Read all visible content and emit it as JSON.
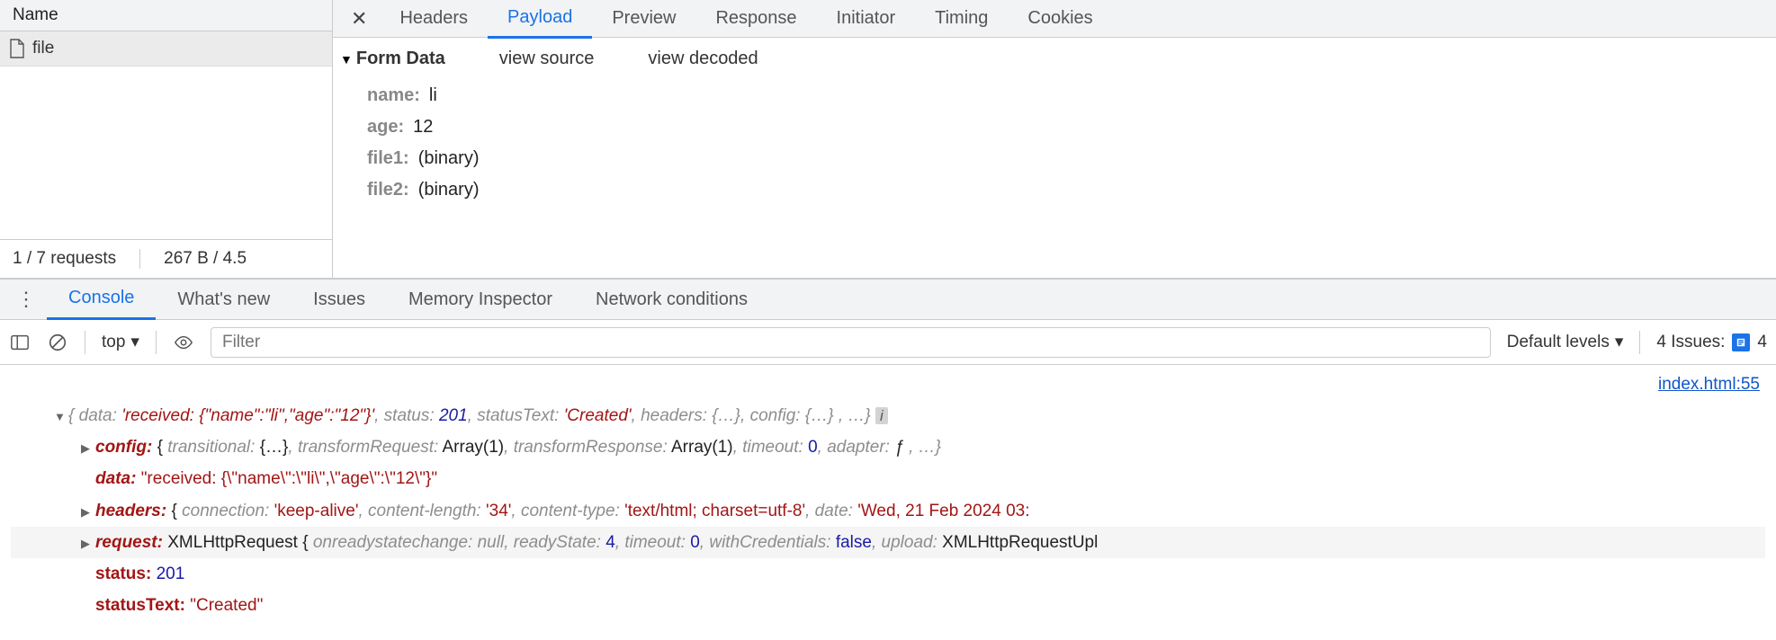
{
  "sidebar": {
    "header": "Name",
    "items": [
      {
        "name": "file"
      }
    ],
    "status_requests": "1 / 7 requests",
    "status_transfer": "267 B / 4.5"
  },
  "detail_tabs": {
    "close": "✕",
    "items": [
      "Headers",
      "Payload",
      "Preview",
      "Response",
      "Initiator",
      "Timing",
      "Cookies"
    ],
    "active": "Payload"
  },
  "payload": {
    "section_label": "Form Data",
    "view_source": "view source",
    "view_decoded": "view decoded",
    "rows": [
      {
        "k": "name:",
        "v": "li"
      },
      {
        "k": "age:",
        "v": "12"
      },
      {
        "k": "file1:",
        "v": "(binary)"
      },
      {
        "k": "file2:",
        "v": "(binary)"
      }
    ]
  },
  "drawer_tabs": {
    "items": [
      "Console",
      "What's new",
      "Issues",
      "Memory Inspector",
      "Network conditions"
    ],
    "active": "Console"
  },
  "console_toolbar": {
    "context": "top",
    "filter_placeholder": "Filter",
    "levels_label": "Default levels",
    "issues_label": "4 Issues:",
    "issues_count": "4"
  },
  "console": {
    "source_link": "index.html:55",
    "line0_pre": "{",
    "line0_k_data": "data:",
    "line0_v_data": "'received: {\"name\":\"li\",\"age\":\"12\"}'",
    "line0_k_status": "status:",
    "line0_v_status": "201",
    "line0_k_statustext": "statusText:",
    "line0_v_statustext": "'Created'",
    "line0_k_headers": "headers:",
    "line0_v_headers": "{…}",
    "line0_k_config": "config:",
    "line0_v_config": "{…}",
    "line0_trail": ", …}",
    "line1_k": "config:",
    "line1_body_a": "{",
    "line1_transitional_k": "transitional:",
    "line1_transitional_v": "{…}",
    "line1_treq_k": "transformRequest:",
    "line1_treq_v": "Array(1)",
    "line1_tres_k": "transformResponse:",
    "line1_tres_v": "Array(1)",
    "line1_timeout_k": "timeout:",
    "line1_timeout_v": "0",
    "line1_adapter_k": "adapter:",
    "line1_adapter_v": "ƒ",
    "line1_trail": ", …}",
    "line2_k": "data:",
    "line2_v": "\"received: {\\\"name\\\":\\\"li\\\",\\\"age\\\":\\\"12\\\"}\"",
    "line3_k": "headers:",
    "line3_body_a": "{",
    "line3_conn_k": "connection:",
    "line3_conn_v": "'keep-alive'",
    "line3_cl_k": "content-length:",
    "line3_cl_v": "'34'",
    "line3_ct_k": "content-type:",
    "line3_ct_v": "'text/html; charset=utf-8'",
    "line3_date_k": "date:",
    "line3_date_v": "'Wed, 21 Feb 2024 03:",
    "line4_k": "request:",
    "line4_type": "XMLHttpRequest ",
    "line4_body_a": "{",
    "line4_or_k": "onreadystatechange:",
    "line4_or_v": "null",
    "line4_rs_k": "readyState:",
    "line4_rs_v": "4",
    "line4_to_k": "timeout:",
    "line4_to_v": "0",
    "line4_wc_k": "withCredentials:",
    "line4_wc_v": "false",
    "line4_up_k": "upload:",
    "line4_up_v": "XMLHttpRequestUpl",
    "line5_k": "status:",
    "line5_v": "201",
    "line6_k": "statusText:",
    "line6_v": "\"Created\""
  }
}
